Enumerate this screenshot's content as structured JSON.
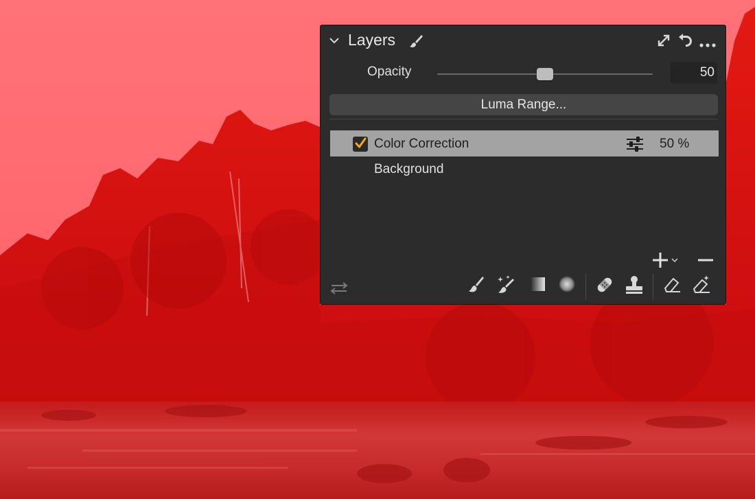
{
  "panel": {
    "title": "Layers",
    "opacity": {
      "label": "Opacity",
      "value": "50",
      "level": 0.5
    },
    "luma_button": "Luma Range...",
    "layers": [
      {
        "name": "Color Correction",
        "opacity": "50 %",
        "checked": true,
        "selected": true
      },
      {
        "name": "Background"
      }
    ]
  },
  "icons": {
    "collapse": "chevron-down-icon",
    "title_brush": "brush-icon",
    "header_right": [
      "expand-icon",
      "reset-icon",
      "more-icon"
    ],
    "layer_adjust": "sliders-icon",
    "add": "plus-icon",
    "add_menu": "chevron-down-icon",
    "remove": "minus-icon",
    "toolbar": [
      "draw-mask-icon",
      "magic-brush-icon",
      "linear-gradient-icon",
      "radial-gradient-icon",
      "heal-icon",
      "clone-stamp-icon",
      "erase-mask-icon",
      "magic-erase-icon"
    ],
    "layer_settings": "adjustments-icon"
  },
  "colors": {
    "panel_bg": "#2c2c2c",
    "selected_row": "#a3a3a3",
    "checkbox_check": "#f5a623",
    "overlay": "#ff0000"
  }
}
